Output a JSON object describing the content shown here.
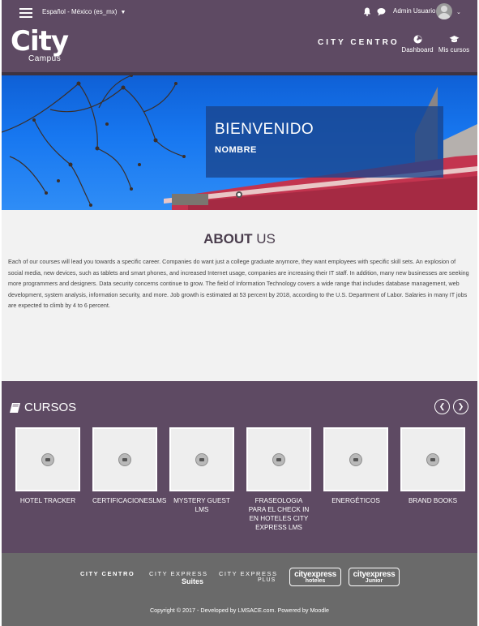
{
  "topbar": {
    "language": "Español - México (es_mx)",
    "user_name": "Admin Usuario"
  },
  "header": {
    "logo_city": "City",
    "logo_campus": "Campus",
    "brand": "CITY CENTRO",
    "nav": [
      {
        "label": "Dashboard",
        "icon": "dashboard-icon"
      },
      {
        "label": "Mis cursos",
        "icon": "graduation-cap-icon"
      }
    ]
  },
  "hero": {
    "title": "BIENVENIDO",
    "subtitle": "NOMBRE"
  },
  "about": {
    "title_bold": "ABOUT",
    "title_rest": " US",
    "text": "Each of our courses will lead you towards a specific career. Companies do want just a college graduate anymore, they want employees with specific skill sets. An explosion of social media, new devices, such as tablets and smart phones, and increased Internet usage, companies are increasing their IT staff. In addition, many new businesses are seeking more programmers and designers. Data security concerns continue to grow. The field of Information Technology covers a wide range that includes database management, web development, system analysis, information security, and more. Job growth is estimated at 53 percent by 2018, according to the U.S. Department of Labor. Salaries in many IT jobs are expected to climb by 4 to 6 percent."
  },
  "cursos": {
    "title": "CURSOS",
    "courses": [
      {
        "label": "HOTEL TRACKER"
      },
      {
        "label": "CERTIFICACIONESLMS"
      },
      {
        "label": "MYSTERY GUEST LMS"
      },
      {
        "label": "FRASEOLOGIA PARA EL CHECK IN EN HOTELES CITY EXPRESS LMS"
      },
      {
        "label": "ENERGÉTICOS"
      },
      {
        "label": "BRAND BOOKS"
      }
    ]
  },
  "footer": {
    "brands": {
      "centro": "CITY CENTRO",
      "suites_top": "CITY EXPRESS",
      "suites_sub": "Suites",
      "plus_top": "CITY EXPRESS",
      "plus_sub": "PLUS",
      "hoteles_main": "cityexpress",
      "hoteles_sub": "hoteles",
      "junior_main": "cityexpress",
      "junior_sub": "Junior"
    },
    "copyright": "Copyright © 2017 - Developed by LMSACE.com. Powered by Moodle"
  },
  "colors": {
    "brand_purple": "#5e4a63",
    "footer_gray": "#6a6a6a",
    "about_bg": "#f2f2f2",
    "sky_blue": "#1777f0"
  }
}
